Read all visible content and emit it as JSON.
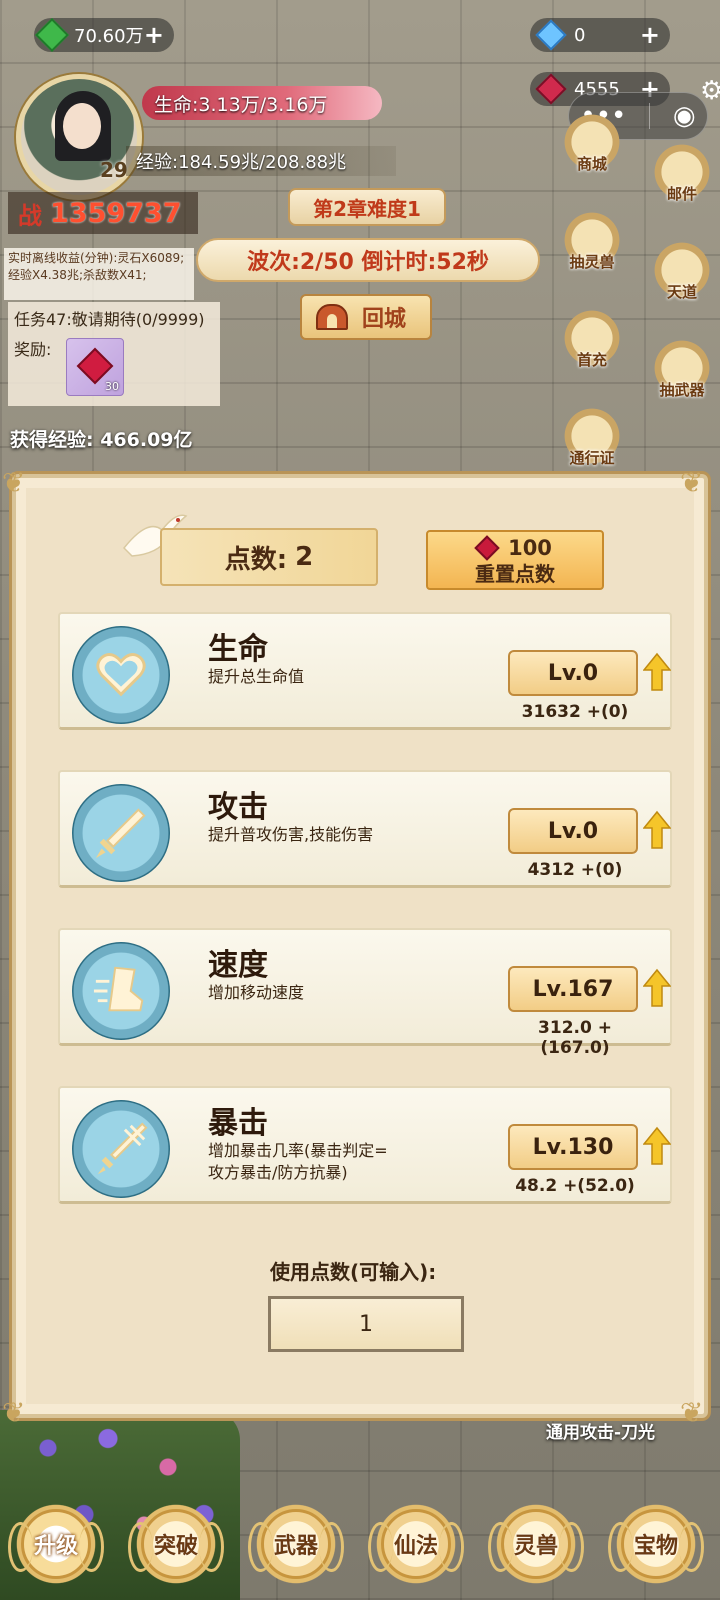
{
  "resources": {
    "green_gems": "70.60万",
    "diamonds": "0",
    "red_gems": "4555"
  },
  "player": {
    "level": "29",
    "hp": "生命:3.13万/3.16万",
    "exp": "经验:184.59兆/208.88兆",
    "power_label": "战",
    "power_value": "1359737"
  },
  "stage": {
    "chapter": "第2章难度1",
    "wave": "波次:2/50 倒计时:52秒",
    "back_city": "回城"
  },
  "offline": {
    "text": "实时离线收益(分钟):灵石X6089;经验X4.38兆;杀敌数X41;"
  },
  "task": {
    "title": "任务47:敬请期待(0/9999)",
    "reward_label": "奖励:",
    "reward_count": "30"
  },
  "gain_exp": "获得经验: 466.09亿",
  "side_menu": [
    {
      "label": "商城",
      "icon": "shop-icon"
    },
    {
      "label": "邮件",
      "icon": "mail-icon"
    },
    {
      "label": "抽灵兽",
      "icon": "pet-draw-icon"
    },
    {
      "label": "天道",
      "icon": "taiji-icon"
    },
    {
      "label": "首充",
      "icon": "first-recharge-icon"
    },
    {
      "label": "抽武器",
      "icon": "weapon-draw-icon"
    },
    {
      "label": "通行证",
      "icon": "pass-icon"
    }
  ],
  "panel": {
    "points_label": "点数:",
    "points_value": "2",
    "reset_cost": "100",
    "reset_label": "重置点数",
    "stats": [
      {
        "name": "生命",
        "desc": "提升总生命值",
        "level": "Lv.0",
        "value": "31632 +(0)",
        "icon": "heart-icon"
      },
      {
        "name": "攻击",
        "desc": "提升普攻伤害,技能伤害",
        "level": "Lv.0",
        "value": "4312 +(0)",
        "icon": "sword-icon"
      },
      {
        "name": "速度",
        "desc": "增加移动速度",
        "level": "Lv.167",
        "value": "312.0 +(167.0)",
        "icon": "boot-icon"
      },
      {
        "name": "暴击",
        "desc": "增加暴击几率(暴击判定=",
        "desc2": "攻方暴击/防方抗暴)",
        "level": "Lv.130",
        "value": "48.2 +(52.0)",
        "icon": "crit-sword-icon"
      }
    ],
    "use_points_label": "使用点数(可输入):",
    "use_points_value": "1"
  },
  "skill_text": "通用攻击-刀光",
  "bottom_nav": [
    "升级",
    "突破",
    "武器",
    "仙法",
    "灵兽",
    "宝物"
  ],
  "colors": {
    "accent_red": "#c0391b",
    "power_red": "#ff5030",
    "panel_bg": "#efe1c6",
    "icon_blue": "#9bd4e6"
  }
}
